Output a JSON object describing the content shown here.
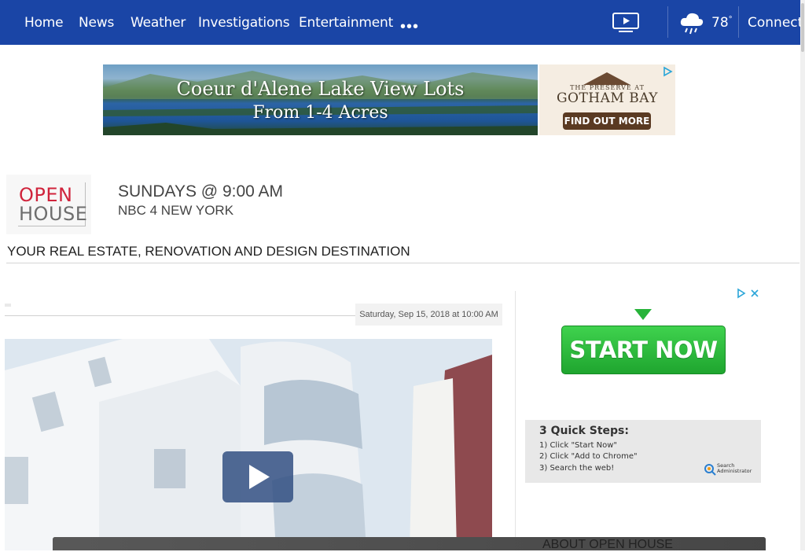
{
  "nav": {
    "items": [
      "Home",
      "News",
      "Weather",
      "Investigations",
      "Entertainment"
    ],
    "more_label": "•••",
    "temperature": "78",
    "temperature_unit": "°",
    "connect_label": "Connect",
    "bg_color": "#1a45a6"
  },
  "top_ad": {
    "headline_line1": "Coeur d'Alene Lake View Lots",
    "headline_line2": "From 1-4 Acres",
    "brand_sub": "THE PRESERVE AT",
    "brand_title": "GOTHAM BAY",
    "cta": "FIND OUT MORE"
  },
  "show": {
    "logo_open": "OPEN",
    "logo_house": "HOUSE",
    "schedule": "SUNDAYS @ 9:00 AM",
    "station": "NBC 4 NEW YORK",
    "tagline": "YOUR REAL ESTATE, RENOVATION AND DESIGN DESTINATION"
  },
  "article": {
    "date": "Saturday, Sep 15, 2018 at 10:00 AM"
  },
  "side_ad": {
    "cta": "START NOW",
    "cta_color": "#2bbf3c",
    "steps_title": "3 Quick Steps:",
    "steps": [
      "1) Click \"Start Now\"",
      "2) Click \"Add to Chrome\"",
      "3) Search the web!"
    ],
    "brand_line1": "Search",
    "brand_line2": "Administrator"
  },
  "about": {
    "label": "ABOUT OPEN HOUSE"
  }
}
